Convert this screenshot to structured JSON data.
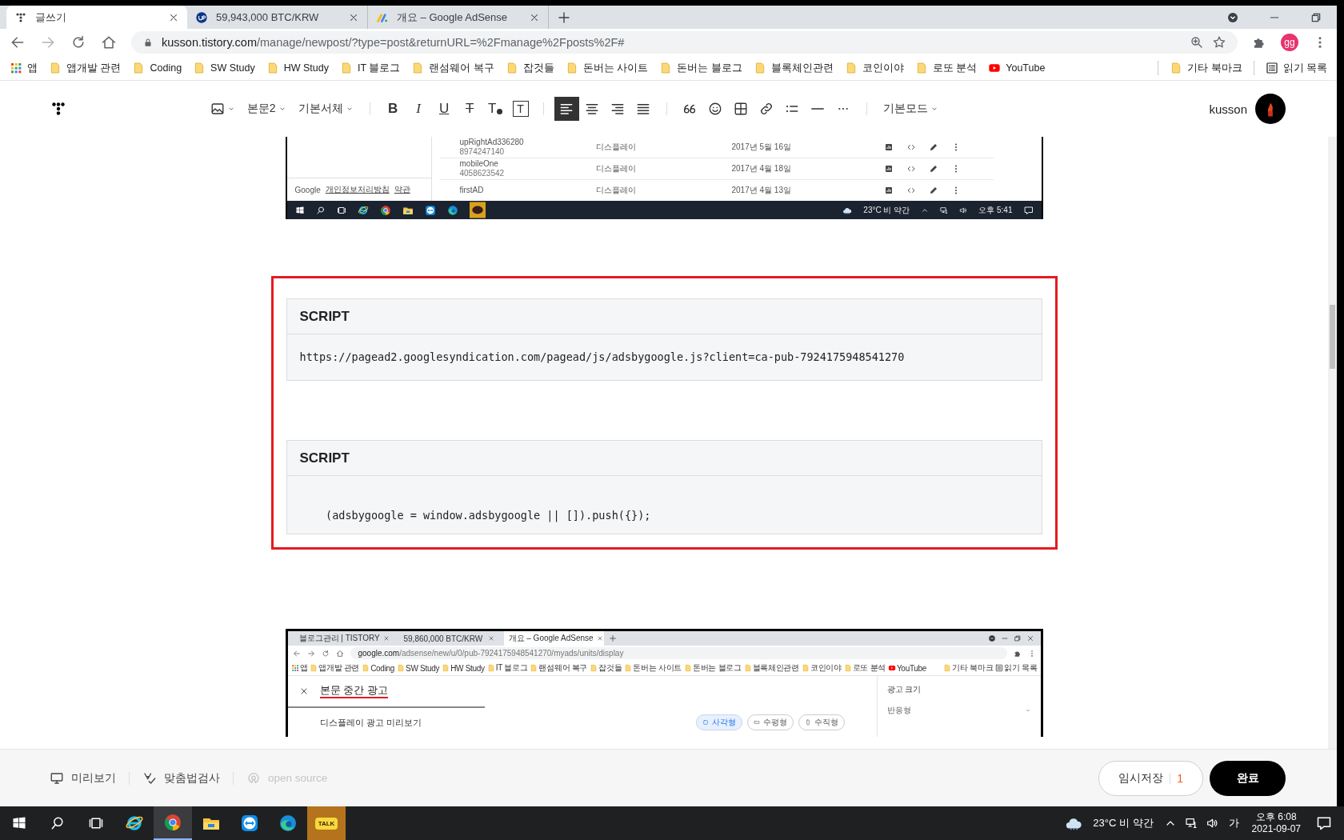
{
  "browser": {
    "tabs": [
      {
        "title": "글쓰기",
        "selected": true
      },
      {
        "title": "59,943,000 BTC/KRW",
        "selected": false
      },
      {
        "title": "개요 – Google AdSense",
        "selected": false
      }
    ],
    "url_host": "kusson.tistory.com",
    "url_path": "/manage/newpost/?type=post&returnURL=%2Fmanage%2Fposts%2F#",
    "profile": "gg",
    "bookmarks": [
      {
        "label": "앱",
        "kind": "apps"
      },
      {
        "label": "앱개발 관련",
        "kind": "folder"
      },
      {
        "label": "Coding",
        "kind": "folder"
      },
      {
        "label": "SW Study",
        "kind": "folder"
      },
      {
        "label": "HW Study",
        "kind": "folder"
      },
      {
        "label": "IT 블로그",
        "kind": "folder"
      },
      {
        "label": "랜섬웨어 복구",
        "kind": "folder"
      },
      {
        "label": "잡것들",
        "kind": "folder"
      },
      {
        "label": "돈버는 사이트",
        "kind": "folder"
      },
      {
        "label": "돈버는 블로그",
        "kind": "folder"
      },
      {
        "label": "블록체인관련",
        "kind": "folder"
      },
      {
        "label": "코인이야",
        "kind": "folder"
      },
      {
        "label": "로또 분석",
        "kind": "folder"
      },
      {
        "label": "YouTube",
        "kind": "youtube"
      }
    ],
    "bookmarks_right": [
      {
        "label": "기타 북마크",
        "kind": "folder"
      },
      {
        "label": "읽기 목록",
        "kind": "reading"
      }
    ]
  },
  "toolbar": {
    "groups": [
      [
        {
          "kind": "image"
        },
        {
          "kind": "dropdown",
          "label": "본문2"
        },
        {
          "kind": "dropdown",
          "label": "기본서체"
        }
      ],
      [
        {
          "kind": "bold",
          "label": "B"
        },
        {
          "kind": "italic",
          "label": "I"
        },
        {
          "kind": "underline",
          "label": "U"
        },
        {
          "kind": "strike",
          "label": "T"
        },
        {
          "kind": "textcolor",
          "label": "T"
        },
        {
          "kind": "textbg",
          "label": "T"
        }
      ],
      [
        {
          "kind": "align-left",
          "selected": true
        },
        {
          "kind": "align-center",
          "selected": false
        },
        {
          "kind": "align-right",
          "selected": false
        },
        {
          "kind": "justify",
          "selected": false
        }
      ],
      [
        {
          "kind": "quote"
        },
        {
          "kind": "emoji"
        },
        {
          "kind": "table"
        },
        {
          "kind": "link"
        },
        {
          "kind": "list"
        },
        {
          "kind": "hr"
        },
        {
          "kind": "more"
        }
      ],
      [
        {
          "kind": "dropdown",
          "label": "기본모드"
        }
      ]
    ],
    "user": "kusson"
  },
  "post": {
    "screenshot_top": {
      "rows": [
        {
          "name": "upRightAd336280",
          "id": "8974247140",
          "type": "디스플레이",
          "date": "2017년 5월 16일"
        },
        {
          "name": "mobileOne",
          "id": "4058623542",
          "type": "디스플레이",
          "date": "2017년 4월 18일"
        },
        {
          "name": "firstAD",
          "type": "디스플레이",
          "date": "2017년 4월 13일"
        }
      ],
      "footer": {
        "brand": "Google",
        "links": [
          "개인정보처리방침",
          "약관"
        ]
      },
      "weather": "23°C 비 약간",
      "time": "오후 5:41"
    },
    "code_blocks": [
      {
        "title": "SCRIPT",
        "code": "https://pagead2.googlesyndication.com/pagead/js/adsbygoogle.js?client=ca-pub-7924175948541270"
      },
      {
        "title": "SCRIPT",
        "code": "    (adsbygoogle = window.adsbygoogle || []).push({});"
      }
    ],
    "screenshot_bottom": {
      "tabs": [
        {
          "title": "블로그관리 | TISTORY",
          "selected": false
        },
        {
          "title": "59,860,000 BTC/KRW",
          "selected": false
        },
        {
          "title": "개요 – Google AdSense",
          "selected": true
        }
      ],
      "url_host": "google.com",
      "url_path": "/adsense/new/u/0/pub-7924175948541270/myads/units/display",
      "bookmarks": [
        {
          "label": "앱",
          "kind": "apps"
        },
        {
          "label": "앱개발 관련",
          "kind": "folder"
        },
        {
          "label": "Coding",
          "kind": "folder"
        },
        {
          "label": "SW Study",
          "kind": "folder"
        },
        {
          "label": "HW Study",
          "kind": "folder"
        },
        {
          "label": "IT 블로그",
          "kind": "folder"
        },
        {
          "label": "랜섬웨어 복구",
          "kind": "folder"
        },
        {
          "label": "잡것들",
          "kind": "folder"
        },
        {
          "label": "돈버는 사이트",
          "kind": "folder"
        },
        {
          "label": "돈버는 블로그",
          "kind": "folder"
        },
        {
          "label": "블록체인관련",
          "kind": "folder"
        },
        {
          "label": "코인이야",
          "kind": "folder"
        },
        {
          "label": "로또 분석",
          "kind": "folder"
        },
        {
          "label": "YouTube",
          "kind": "youtube"
        }
      ],
      "bookmarks_right": [
        {
          "label": "기타 북마크",
          "kind": "folder"
        },
        {
          "label": "읽기 목록",
          "kind": "reading"
        }
      ],
      "page_title": "본문 중간 광고",
      "preview_label": "디스플레이 광고 미리보기",
      "shapes": [
        {
          "label": "사각형",
          "selected": true
        },
        {
          "label": "수평형",
          "selected": false
        },
        {
          "label": "수직형",
          "selected": false
        }
      ],
      "side_title": "광고 크기",
      "side_value": "반응형"
    }
  },
  "bottom_bar": {
    "actions": [
      {
        "kind": "preview",
        "label": "미리보기",
        "disabled": false
      },
      {
        "kind": "spellcheck",
        "label": "맞춤법검사",
        "disabled": false
      },
      {
        "kind": "opensource",
        "label": "open source",
        "disabled": true
      }
    ],
    "draft_label": "임시저장",
    "draft_count": "1",
    "publish_label": "완료"
  },
  "taskbar": {
    "apps": [
      {
        "kind": "ie",
        "active": false
      },
      {
        "kind": "chrome",
        "active": true
      },
      {
        "kind": "explorer",
        "active": false
      },
      {
        "kind": "teamviewer",
        "active": false
      },
      {
        "kind": "edge",
        "active": false
      },
      {
        "kind": "kakao",
        "label": "TALK",
        "active": false
      }
    ],
    "weather": "23°C 비 약간",
    "ime": "가",
    "time": "오후 6:08",
    "date": "2021-09-07"
  }
}
